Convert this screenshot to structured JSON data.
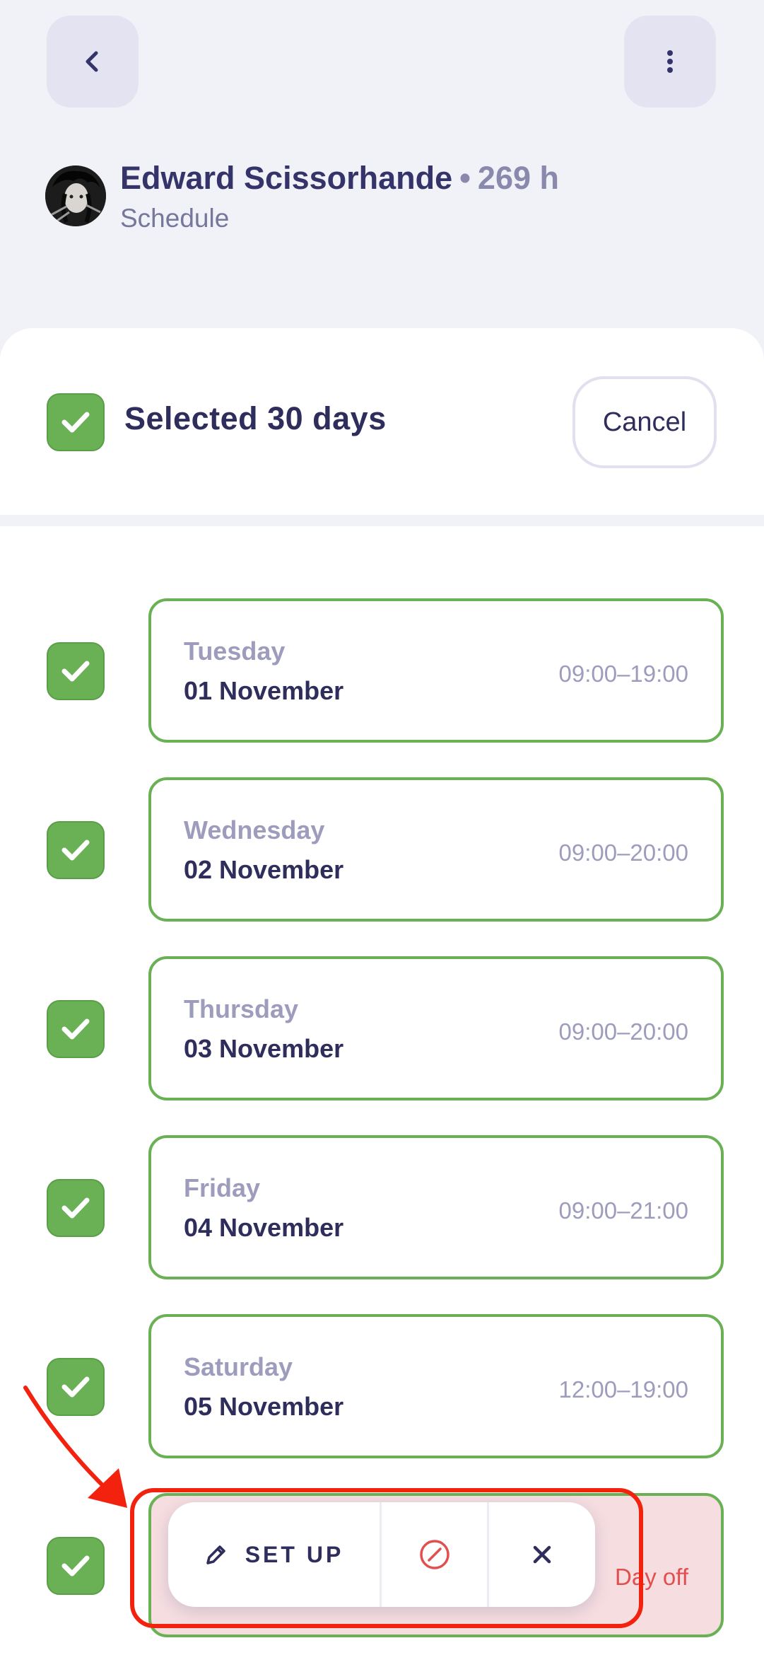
{
  "header": {
    "name": "Edward Scissorhande",
    "separator": "•",
    "hours": "269 h",
    "subtitle": "Schedule"
  },
  "selection": {
    "text": "Selected 30 days",
    "cancel_label": "Cancel"
  },
  "days": [
    {
      "weekday": "Tuesday",
      "date": "01 November",
      "time": "09:00–19:00",
      "checked": true
    },
    {
      "weekday": "Wednesday",
      "date": "02 November",
      "time": "09:00–20:00",
      "checked": true
    },
    {
      "weekday": "Thursday",
      "date": "03 November",
      "time": "09:00–20:00",
      "checked": true
    },
    {
      "weekday": "Friday",
      "date": "04 November",
      "time": "09:00–21:00",
      "checked": true
    },
    {
      "weekday": "Saturday",
      "date": "05 November",
      "time": "12:00–19:00",
      "checked": true
    },
    {
      "weekday": "",
      "date": "",
      "time": "Day off",
      "checked": true
    }
  ],
  "actions": {
    "setup_label": "SET UP"
  },
  "colors": {
    "accent_green": "#6ab155",
    "day_off_red": "#e24f4f",
    "annotation_red": "#f2220f"
  }
}
